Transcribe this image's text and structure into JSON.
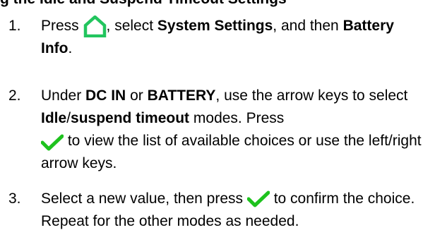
{
  "page": {
    "heading_fragment": "g the Idle and Suspend Timeout Settings"
  },
  "steps": [
    {
      "number": "1.",
      "parts": {
        "t1": "Press",
        "t2": ", select",
        "b1": "System Settings",
        "t3": ", and then",
        "b2": "Battery Info",
        "t4": "."
      }
    },
    {
      "number": "2.",
      "parts": {
        "t1": "Under",
        "b1": "DC IN",
        "t2": "or",
        "b2": "BATTERY",
        "t3": ", use the arrow keys to select",
        "b3": "Idle",
        "t4": "/",
        "b4": "suspend timeout",
        "t5": "modes. Press",
        "t6": "to view the list of available choices or use the left/right arrow keys."
      }
    },
    {
      "number": "3.",
      "parts": {
        "t1": "Select a new value, then press",
        "t2": "to confirm the choice. Repeat for the other modes as needed."
      }
    }
  ],
  "icons": {
    "home": {
      "name": "home-icon",
      "color": "#22c55e"
    },
    "check": {
      "name": "check-icon",
      "color": "#1ec21e"
    }
  }
}
